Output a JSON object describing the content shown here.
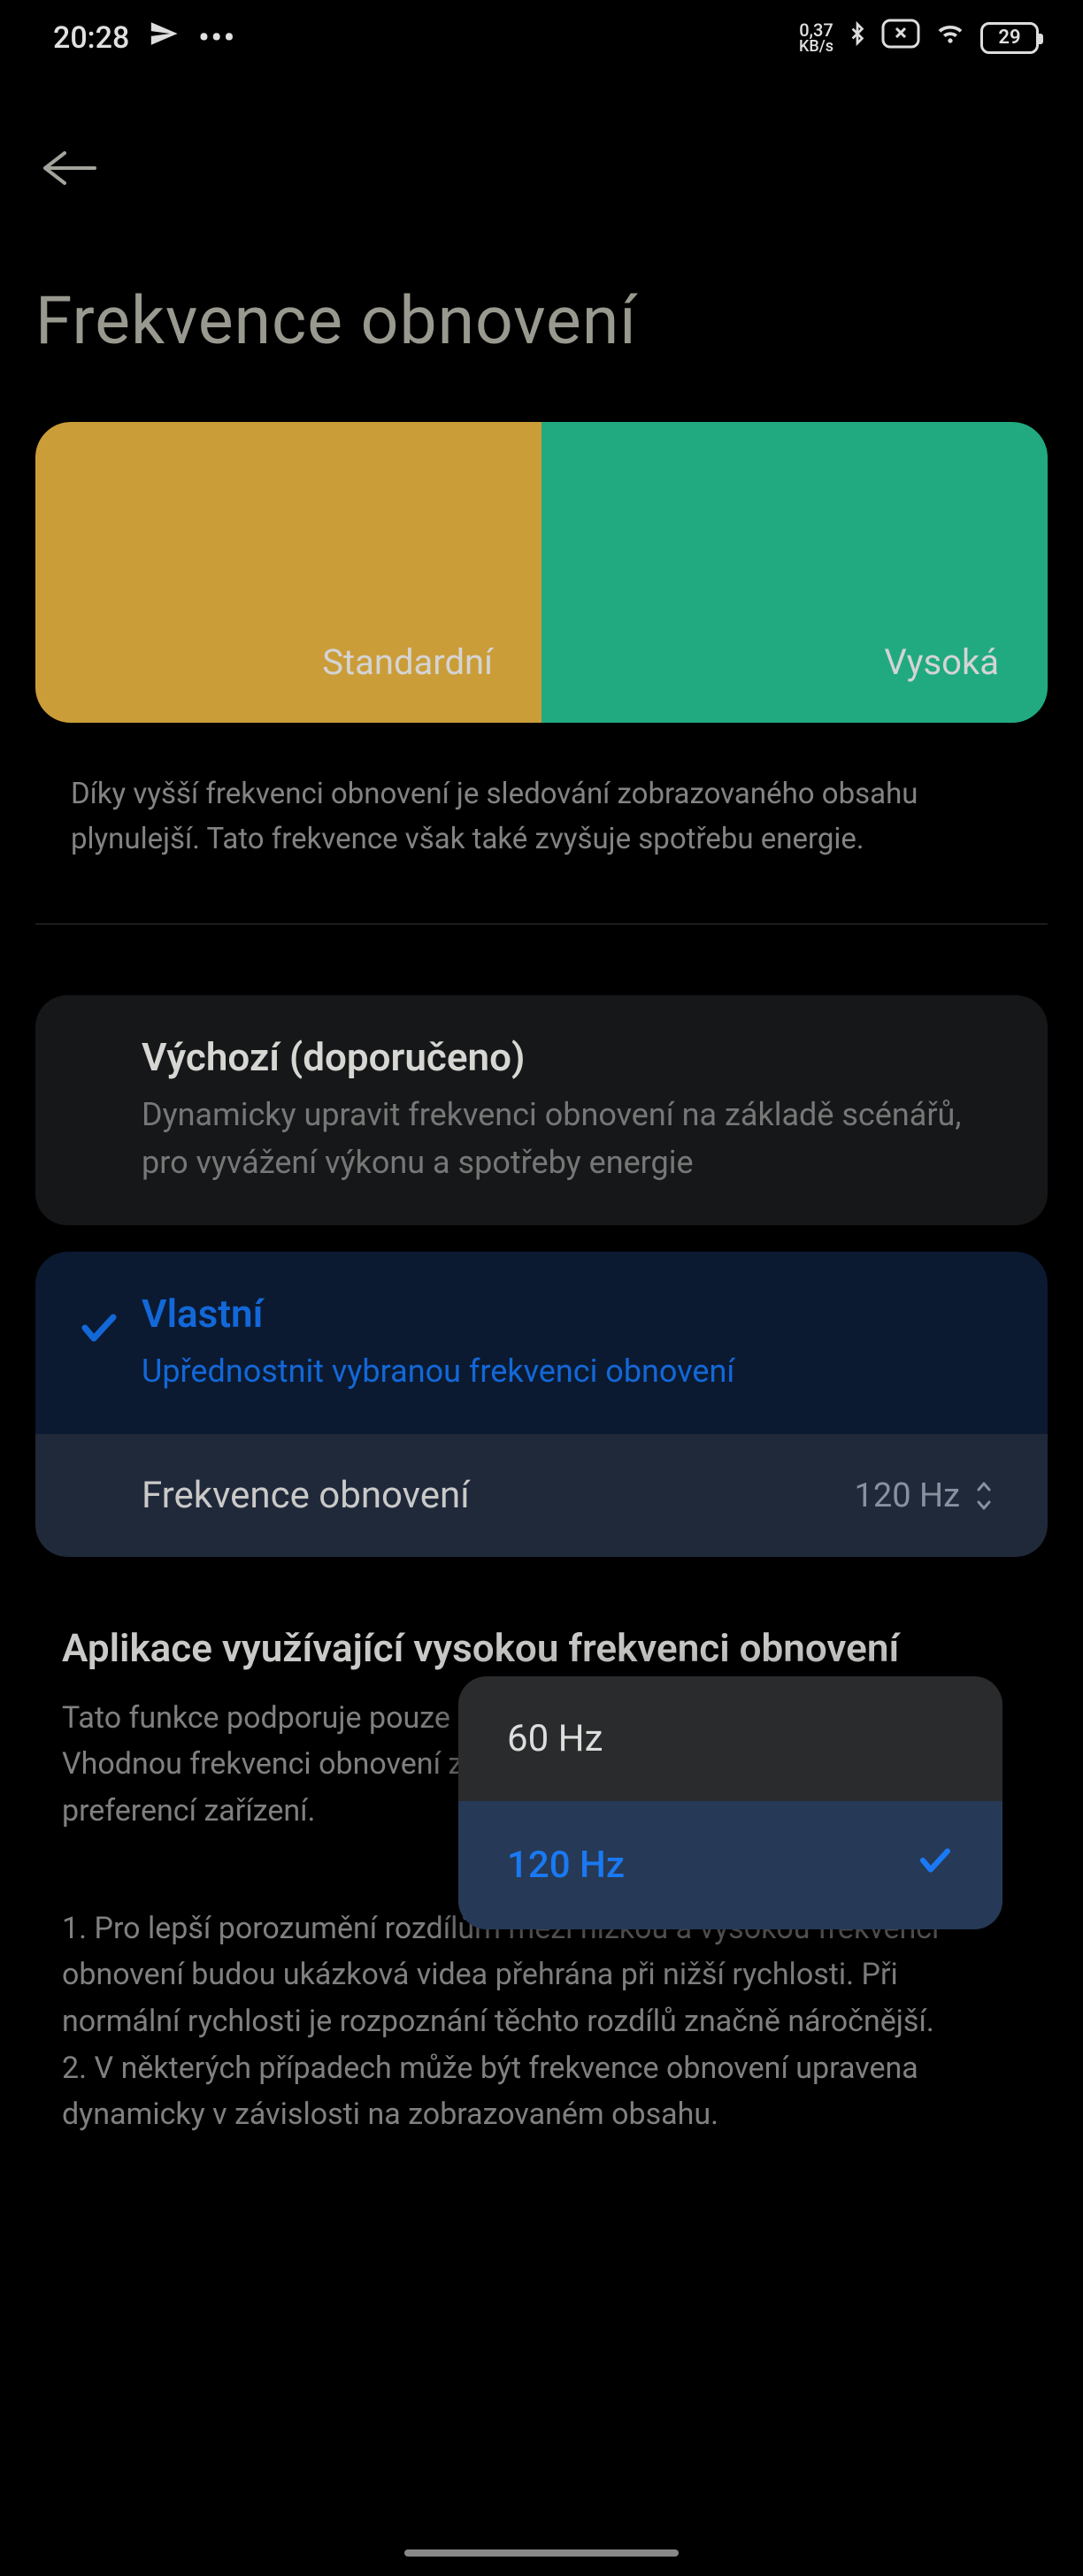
{
  "status": {
    "time": "20:28",
    "net_speed_value": "0,37",
    "net_speed_unit": "KB/s",
    "battery": "29"
  },
  "page": {
    "title": "Frekvence obnovení"
  },
  "preview": {
    "left": "Standardní",
    "right": "Vysoká"
  },
  "description": "Díky vyšší frekvenci obnovení je sledování zobrazovaného obsahu plynulejší. Tato frekvence však také zvyšuje spotřebu energie.",
  "options": {
    "default": {
      "title": "Výchozí (doporučeno)",
      "subtitle": "Dynamicky upravit frekvenci obnovení na základě scénářů, pro vyvážení výkonu a spotřeby energie"
    },
    "custom": {
      "title": "Vlastní",
      "subtitle": "Upřednostnit vybranou frekvenci obnovení"
    }
  },
  "freq_setting": {
    "label": "Frekvence obnovení",
    "value": "120 Hz"
  },
  "app_section": {
    "heading": "Aplikace využívající vysokou frekvenci obnovení",
    "body": "Tato funkce podporuje pouze frekvence obnovení 90 Hz a 120 Hz. Vhodnou frekvenci obnovení zvolí systém automaticky na základě preferencí zařízení."
  },
  "notes": "1. Pro lepší porozumění rozdílům mezi nízkou a vysokou frekvencí obnovení budou ukázková videa přehrána při nižší rychlosti. Při normální rychlosti je rozpoznání těchto rozdílů značně náročnější.\n2. V některých případech může být frekvence obnovení upravena dynamicky v závislosti na zobrazovaném obsahu.",
  "popup": {
    "option1": "60 Hz",
    "option2": "120 Hz"
  }
}
